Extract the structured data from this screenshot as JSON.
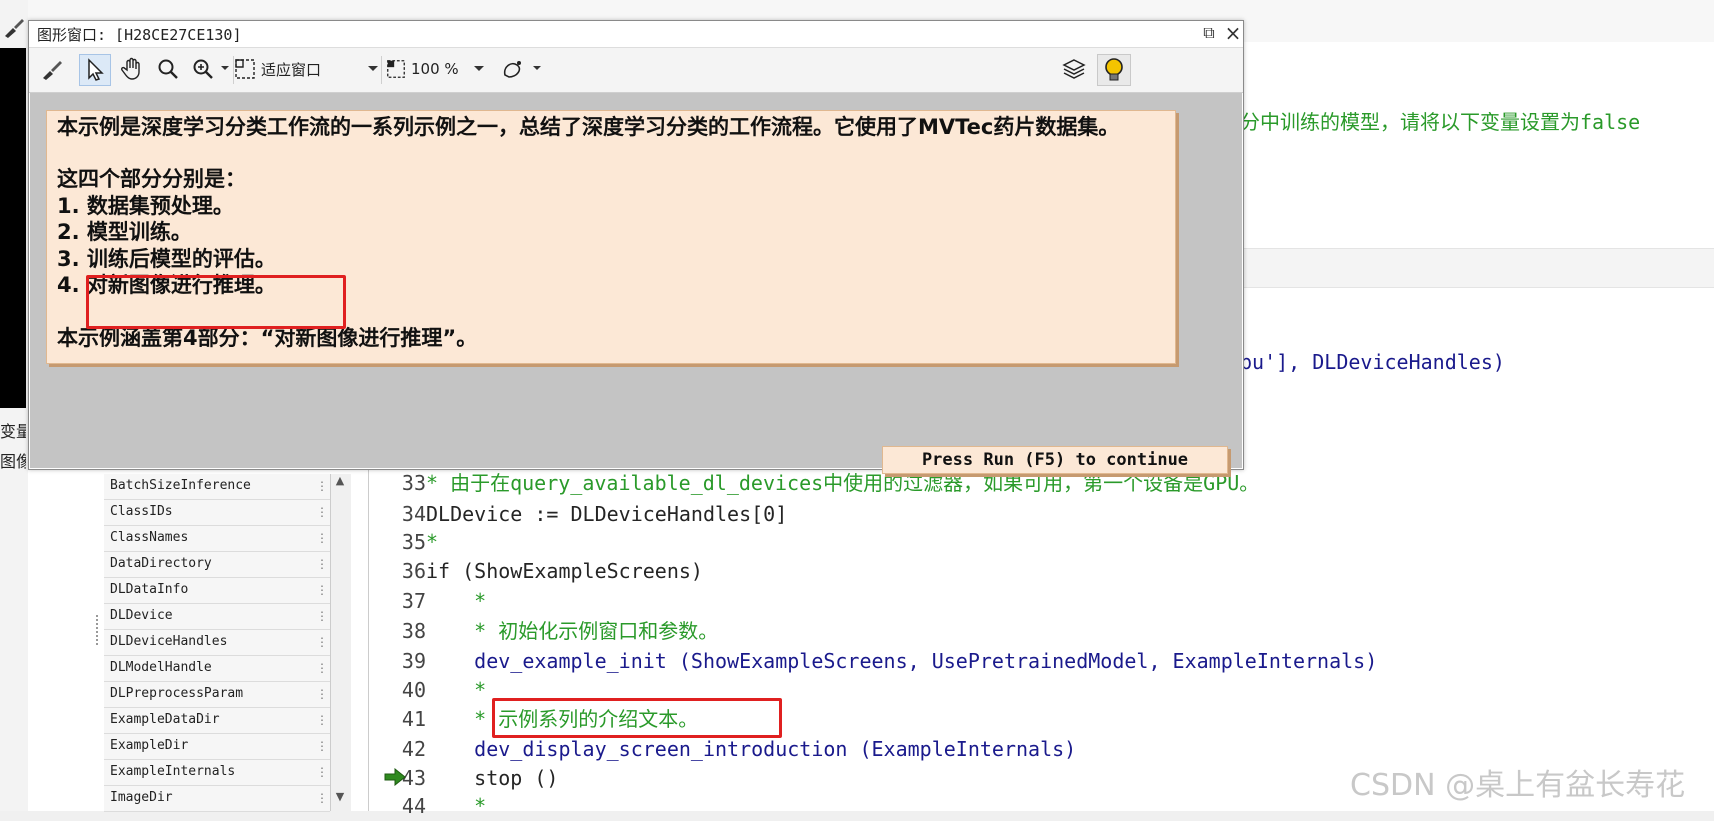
{
  "graphics_window": {
    "title": "图形窗口: [H28CE27CE130]",
    "toolbar": {
      "fit_label": "适应窗口",
      "zoom_label": "100 %"
    },
    "intro_lines": [
      "本示例是深度学习分类工作流的一系列示例之一，总结了深度学习分类的工作流程。它使用了MVTec药片数据集。",
      "这四个部分分别是：",
      "1. 数据集预处理。",
      "2. 模型训练。",
      "3. 训练后模型的评估。",
      "4. 对新图像进行推理。",
      "本示例涵盖第4部分：“对新图像进行推理”。"
    ],
    "continue_prompt": "Press Run (F5) to continue"
  },
  "left_strip": {
    "label_1": "变量",
    "label_2": "图像"
  },
  "variables": [
    "BatchSizeInference",
    "ClassIDs",
    "ClassNames",
    "DataDirectory",
    "DLDataInfo",
    "DLDevice",
    "DLDeviceHandles",
    "DLModelHandle",
    "DLPreprocessParam",
    "ExampleDataDir",
    "ExampleDir",
    "ExampleInternals",
    "ImageDir"
  ],
  "editor": {
    "partial_comment": "分中训练的模型，请将以下变量设置为false",
    "partial_code": "pu'], DLDeviceHandles)",
    "lines": [
      {
        "num": "33",
        "text": "* 由于在query_available_dl_devices中使用的过滤器，如果可用，第一个设备是GPU。"
      },
      {
        "num": "34",
        "text": "DLDevice := DLDeviceHandles[0]"
      },
      {
        "num": "35",
        "text": "*"
      },
      {
        "num": "36",
        "text": "if (ShowExampleScreens)"
      },
      {
        "num": "37",
        "text": "    *"
      },
      {
        "num": "38",
        "text": "    * 初始化示例窗口和参数。"
      },
      {
        "num": "39",
        "text": "    dev_example_init (ShowExampleScreens, UsePretrainedModel, ExampleInternals)"
      },
      {
        "num": "40",
        "text": "    *"
      },
      {
        "num": "41",
        "text": "    * 示例系列的介绍文本。"
      },
      {
        "num": "42",
        "text": "    dev_display_screen_introduction (ExampleInternals)"
      },
      {
        "num": "43",
        "text": "    stop ()"
      },
      {
        "num": "44",
        "text": "    *"
      }
    ]
  },
  "watermark": "CSDN @桌上有盆长寿花",
  "colors": {
    "comment": "#2a9a2a",
    "intro_bg": "#fce8d6",
    "canvas_bg": "#c4c4c4",
    "highlight_box": "#e02020"
  }
}
